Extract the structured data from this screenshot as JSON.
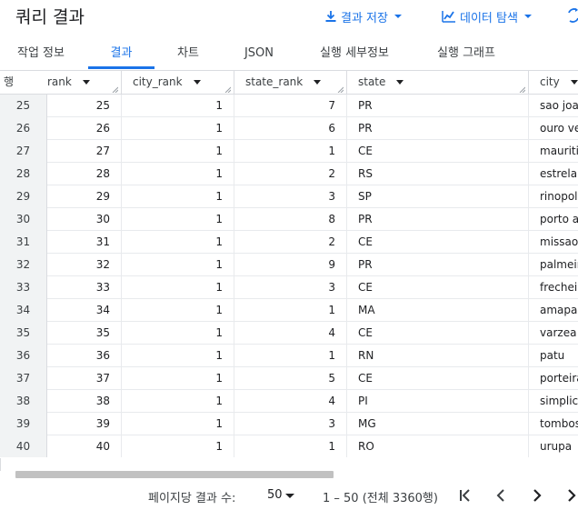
{
  "header": {
    "title": "쿼리 결과",
    "save_label": "결과 저장",
    "explore_label": "데이터 탐색"
  },
  "tabs": [
    {
      "label": "작업 정보"
    },
    {
      "label": "결과"
    },
    {
      "label": "차트"
    },
    {
      "label": "JSON"
    },
    {
      "label": "실행 세부정보"
    },
    {
      "label": "실행 그래프"
    }
  ],
  "columns": {
    "row": "행",
    "rank": "rank",
    "city_rank": "city_rank",
    "state_rank": "state_rank",
    "state": "state",
    "city": "city"
  },
  "rows": [
    {
      "n": "25",
      "rank": "25",
      "city_rank": "1",
      "state_rank": "7",
      "state": "PR",
      "city": "sao joao"
    },
    {
      "n": "26",
      "rank": "26",
      "city_rank": "1",
      "state_rank": "6",
      "state": "PR",
      "city": "ouro verde"
    },
    {
      "n": "27",
      "rank": "27",
      "city_rank": "1",
      "state_rank": "1",
      "state": "CE",
      "city": "mauriti"
    },
    {
      "n": "28",
      "rank": "28",
      "city_rank": "1",
      "state_rank": "2",
      "state": "RS",
      "city": "estrela velha"
    },
    {
      "n": "29",
      "rank": "29",
      "city_rank": "1",
      "state_rank": "3",
      "state": "SP",
      "city": "rinopolis"
    },
    {
      "n": "30",
      "rank": "30",
      "city_rank": "1",
      "state_rank": "8",
      "state": "PR",
      "city": "porto amazonas"
    },
    {
      "n": "31",
      "rank": "31",
      "city_rank": "1",
      "state_rank": "2",
      "state": "CE",
      "city": "missao velha"
    },
    {
      "n": "32",
      "rank": "32",
      "city_rank": "1",
      "state_rank": "9",
      "state": "PR",
      "city": "palmeira"
    },
    {
      "n": "33",
      "rank": "33",
      "city_rank": "1",
      "state_rank": "3",
      "state": "CE",
      "city": "frecheirinha"
    },
    {
      "n": "34",
      "rank": "34",
      "city_rank": "1",
      "state_rank": "1",
      "state": "MA",
      "city": "amapa do maranhao"
    },
    {
      "n": "35",
      "rank": "35",
      "city_rank": "1",
      "state_rank": "4",
      "state": "CE",
      "city": "varzea alegre"
    },
    {
      "n": "36",
      "rank": "36",
      "city_rank": "1",
      "state_rank": "1",
      "state": "RN",
      "city": "patu"
    },
    {
      "n": "37",
      "rank": "37",
      "city_rank": "1",
      "state_rank": "5",
      "state": "CE",
      "city": "porteiras"
    },
    {
      "n": "38",
      "rank": "38",
      "city_rank": "1",
      "state_rank": "4",
      "state": "PI",
      "city": "simplicio mendes"
    },
    {
      "n": "39",
      "rank": "39",
      "city_rank": "1",
      "state_rank": "3",
      "state": "MG",
      "city": "tombos"
    },
    {
      "n": "40",
      "rank": "40",
      "city_rank": "1",
      "state_rank": "1",
      "state": "RO",
      "city": "urupa"
    }
  ],
  "pager": {
    "label": "페이지당 결과 수:",
    "page_size": "50",
    "range": "1 – 50 (전체 3360행)"
  },
  "colors": {
    "accent": "#1a73e8",
    "text": "#202124",
    "divider": "#dadce0"
  },
  "icons": {
    "save": "download-icon",
    "explore": "chart-icon",
    "refresh": "refresh-icon"
  }
}
